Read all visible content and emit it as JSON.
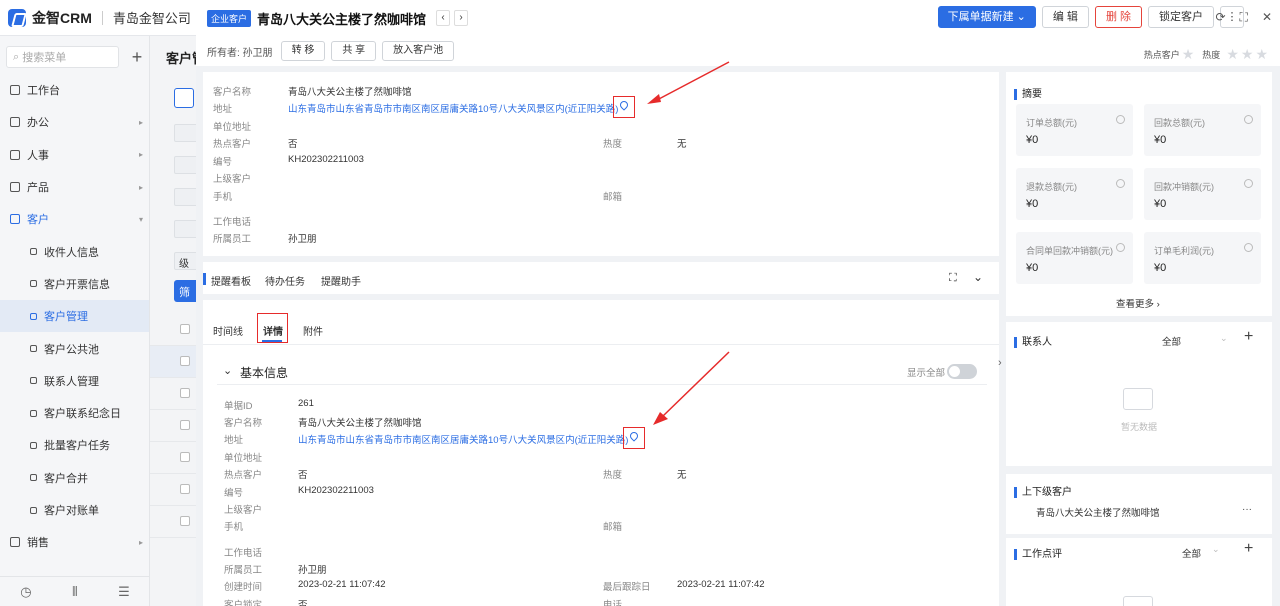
{
  "app": {
    "name": "金智CRM",
    "company": "青岛金智公司"
  },
  "sidebar": {
    "search_placeholder": "搜索菜单",
    "items": [
      {
        "label": "工作台",
        "level": 1
      },
      {
        "label": "办公",
        "level": 1,
        "arrow": "▸"
      },
      {
        "label": "人事",
        "level": 1,
        "arrow": "▸"
      },
      {
        "label": "产品",
        "level": 1,
        "arrow": "▸"
      },
      {
        "label": "客户",
        "level": 1,
        "arrow": "▾",
        "state": "open"
      },
      {
        "label": "收件人信息",
        "level": 2
      },
      {
        "label": "客户开票信息",
        "level": 2
      },
      {
        "label": "客户管理",
        "level": 2,
        "state": "active"
      },
      {
        "label": "客户公共池",
        "level": 2
      },
      {
        "label": "联系人管理",
        "level": 2
      },
      {
        "label": "客户联系纪念日",
        "level": 2
      },
      {
        "label": "批量客户任务",
        "level": 2
      },
      {
        "label": "客户合并",
        "level": 2
      },
      {
        "label": "客户对账单",
        "level": 2
      },
      {
        "label": "销售",
        "level": 1,
        "arrow": "▸"
      }
    ]
  },
  "background_page": {
    "title": "客户管",
    "filter_button": "筛",
    "level_chip": "级"
  },
  "drawer": {
    "tag": "企业客户",
    "title": "青岛八大关公主楼了然咖啡馆",
    "actions": {
      "new_doc": "下属单据新建",
      "edit": "编 辑",
      "delete": "删 除",
      "lock": "锁定客户",
      "more": "⋮"
    },
    "owner_label": "所有者: 孙卫朋",
    "owner_buttons": [
      "转 移",
      "共 享",
      "放入客户池"
    ],
    "hot_customer_label": "热点客户",
    "heat_label": "热度"
  },
  "top_info": {
    "fields": [
      {
        "label": "客户名称",
        "value": "青岛八大关公主楼了然咖啡馆"
      },
      {
        "label": "地址",
        "value": "山东青岛市山东省青岛市市南区南区居庸关路10号八大关风景区内(近正阳关路)",
        "link": true
      },
      {
        "label": "单位地址",
        "value": ""
      },
      {
        "label": "热点客户",
        "value": "否"
      },
      {
        "label": "编号",
        "value": "KH202302211003"
      },
      {
        "label": "上级客户",
        "value": ""
      },
      {
        "label": "手机",
        "value": ""
      },
      {
        "label": "工作电话",
        "value": ""
      },
      {
        "label": "所属员工",
        "value": "孙卫朋"
      }
    ],
    "right_fields": [
      {
        "label": "热度",
        "value": "无"
      },
      {
        "label": "邮箱",
        "value": ""
      }
    ]
  },
  "reminder_tabs": [
    "提醒看板",
    "待办任务",
    "提醒助手"
  ],
  "detail_tabs": [
    "时间线",
    "详情",
    "附件"
  ],
  "basic_info": {
    "title": "基本信息",
    "show_all_label": "显示全部",
    "fields": [
      {
        "label": "单据ID",
        "value": "261"
      },
      {
        "label": "客户名称",
        "value": "青岛八大关公主楼了然咖啡馆"
      },
      {
        "label": "地址",
        "value": "山东青岛市山东省青岛市市南区南区居庸关路10号八大关风景区内(近正阳关路)",
        "link": true
      },
      {
        "label": "单位地址",
        "value": ""
      },
      {
        "label": "热点客户",
        "value": "否"
      },
      {
        "label": "编号",
        "value": "KH202302211003"
      },
      {
        "label": "上级客户",
        "value": ""
      },
      {
        "label": "手机",
        "value": ""
      },
      {
        "label": "工作电话",
        "value": ""
      },
      {
        "label": "所属员工",
        "value": "孙卫朋"
      },
      {
        "label": "创建时间",
        "value": "2023-02-21 11:07:42"
      },
      {
        "label": "客户锁定",
        "value": "否"
      }
    ],
    "right_fields": [
      {
        "label": "热度",
        "value": "无"
      },
      {
        "label": "邮箱",
        "value": ""
      },
      {
        "label": "最后跟踪日",
        "value": "2023-02-21 11:07:42"
      },
      {
        "label": "电话",
        "value": ""
      }
    ]
  },
  "summary": {
    "title": "摘要",
    "stats": [
      {
        "label": "订单总额(元)",
        "value": "¥0"
      },
      {
        "label": "回款总额(元)",
        "value": "¥0"
      },
      {
        "label": "退款总额(元)",
        "value": "¥0"
      },
      {
        "label": "回款冲销额(元)",
        "value": "¥0"
      },
      {
        "label": "合同单回款冲销额(元)",
        "value": "¥0"
      },
      {
        "label": "订单毛利润(元)",
        "value": "¥0"
      }
    ],
    "more": "查看更多"
  },
  "contacts": {
    "title": "联系人",
    "filter": "全部",
    "empty": "暂无数据"
  },
  "hierarchy": {
    "title": "上下级客户",
    "item": "青岛八大关公主楼了然咖啡馆",
    "more": "···"
  },
  "work_review": {
    "title": "工作点评",
    "filter": "全部"
  }
}
